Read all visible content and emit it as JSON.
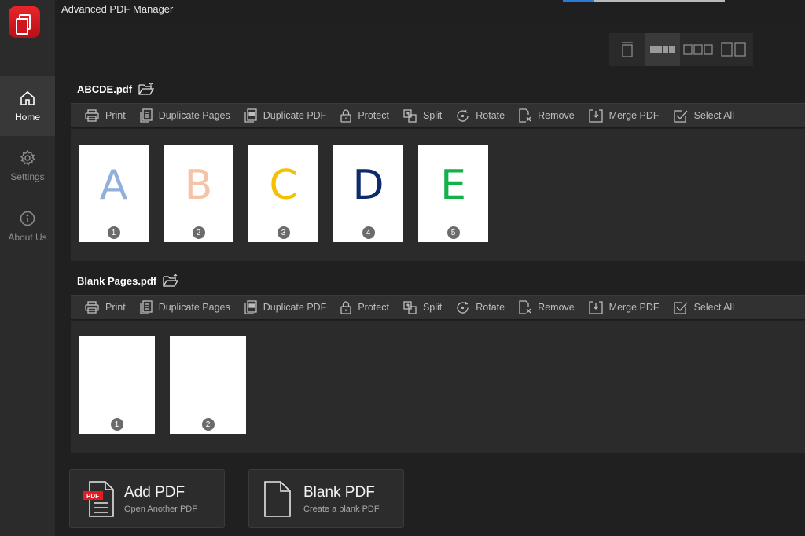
{
  "app": {
    "title": "Advanced PDF Manager"
  },
  "sidebar": {
    "items": [
      {
        "label": "Home",
        "icon": "home-icon",
        "active": true
      },
      {
        "label": "Settings",
        "icon": "gear-icon",
        "active": false
      },
      {
        "label": "About Us",
        "icon": "info-icon",
        "active": false
      }
    ]
  },
  "view_modes": [
    {
      "name": "single-page-view",
      "active": false
    },
    {
      "name": "strip-view",
      "active": true
    },
    {
      "name": "three-column-view",
      "active": false
    },
    {
      "name": "two-column-view",
      "active": false
    }
  ],
  "toolbar": {
    "print": "Print",
    "duplicate_pages": "Duplicate Pages",
    "duplicate_pdf": "Duplicate PDF",
    "protect": "Protect",
    "split": "Split",
    "rotate": "Rotate",
    "remove": "Remove",
    "merge_pdf": "Merge PDF",
    "select_all": "Select All"
  },
  "documents": [
    {
      "name": "ABCDE.pdf",
      "pages": [
        {
          "number": "1",
          "letter": "A",
          "color": "#8fb0dc"
        },
        {
          "number": "2",
          "letter": "B",
          "color": "#f4c4a8"
        },
        {
          "number": "3",
          "letter": "C",
          "color": "#f5c000"
        },
        {
          "number": "4",
          "letter": "D",
          "color": "#0d2a6b"
        },
        {
          "number": "5",
          "letter": "E",
          "color": "#12b14a"
        }
      ]
    },
    {
      "name": "Blank Pages.pdf",
      "pages": [
        {
          "number": "1"
        },
        {
          "number": "2"
        }
      ]
    }
  ],
  "actions": {
    "add_pdf": {
      "title": "Add PDF",
      "subtitle": "Open Another PDF",
      "badge": "PDF"
    },
    "blank_pdf": {
      "title": "Blank PDF",
      "subtitle": "Create a blank PDF"
    }
  },
  "colors": {
    "accent": "#e31b23",
    "sidebar_active": "#383838",
    "background": "#202020"
  }
}
